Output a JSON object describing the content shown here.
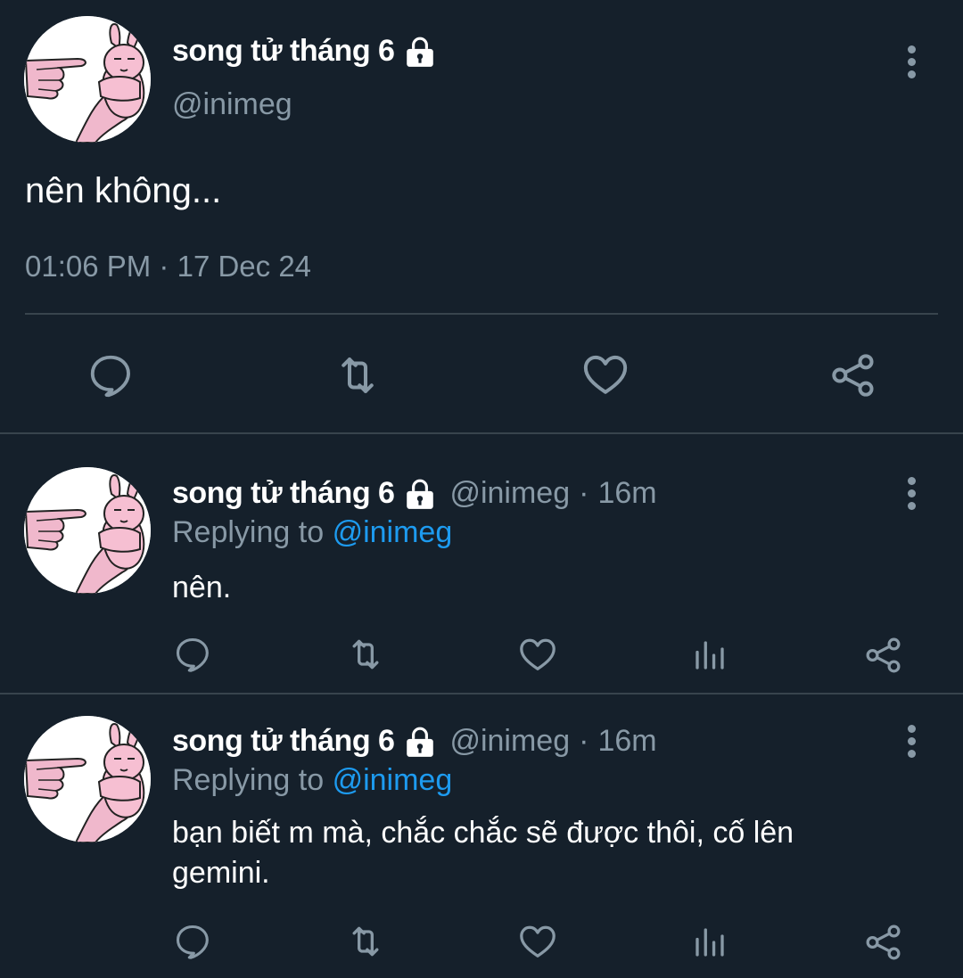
{
  "main_tweet": {
    "display_name": "song tử tháng 6",
    "handle": "@inimeg",
    "text": "nên không...",
    "time": "01:06 PM",
    "separator": "·",
    "date": "17 Dec 24",
    "actions": [
      "reply-icon",
      "retweet-icon",
      "like-icon",
      "share-icon"
    ]
  },
  "replies": [
    {
      "display_name": "song tử tháng 6",
      "handle": "@inimeg",
      "age": "16m",
      "replying_prefix": "Replying to",
      "replying_handle": "@inimeg",
      "text": "nên.",
      "actions": [
        "reply-icon",
        "retweet-icon",
        "like-icon",
        "analytics-icon",
        "share-icon"
      ]
    },
    {
      "display_name": "song tử tháng 6",
      "handle": "@inimeg",
      "age": "16m",
      "replying_prefix": "Replying to",
      "replying_handle": "@inimeg",
      "text": "bạn biết m mà, chắc chắc sẽ được thôi, cố lên gemini.",
      "actions": [
        "reply-icon",
        "retweet-icon",
        "like-icon",
        "analytics-icon",
        "share-icon"
      ]
    }
  ],
  "colors": {
    "background": "#15202b",
    "secondary_text": "#8899a6",
    "link": "#1d9bf0",
    "divider": "#38444d"
  }
}
